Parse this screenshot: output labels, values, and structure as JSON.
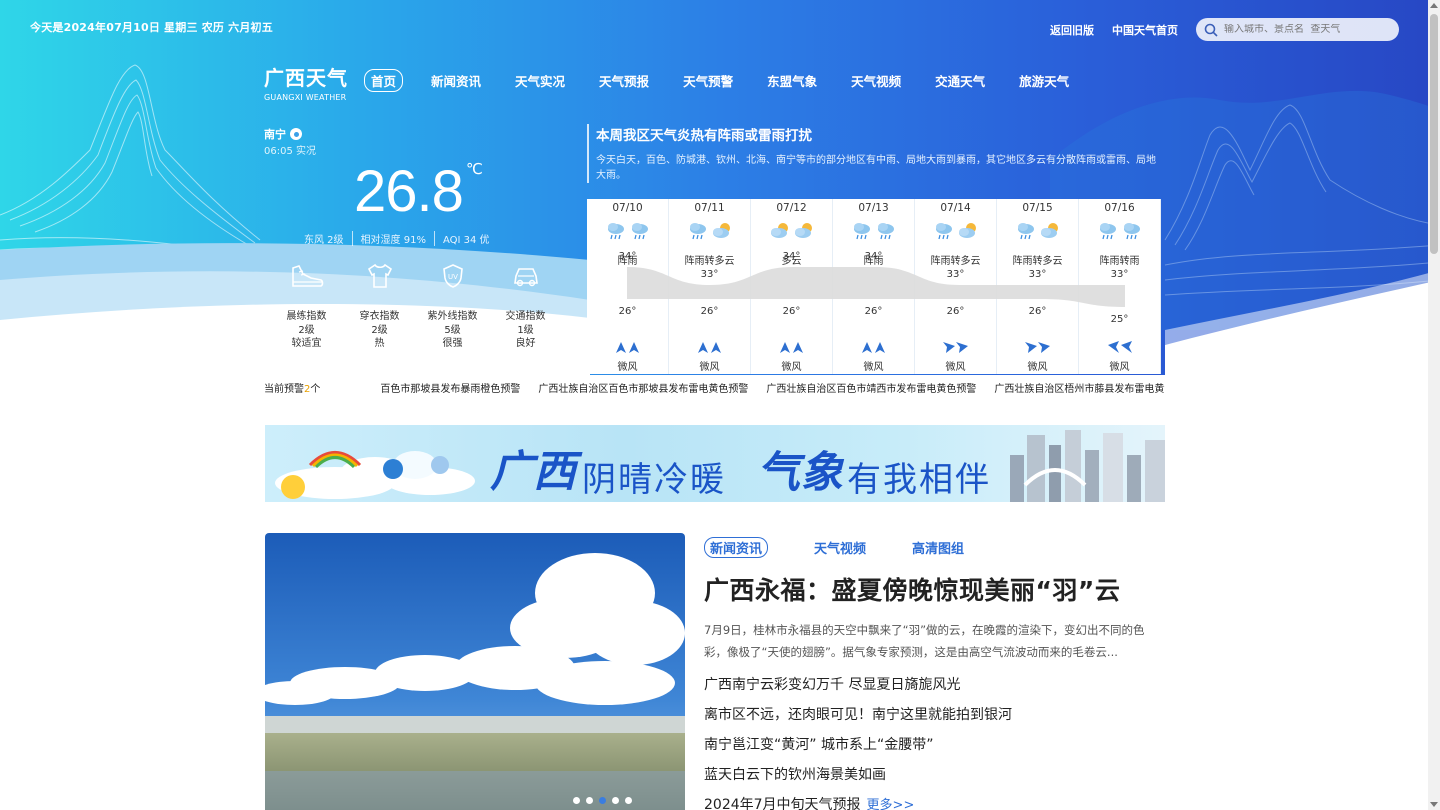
{
  "date_line": "今天是2024年07月10日   星期三   农历 六月初五",
  "top_links": {
    "old_version": "返回旧版",
    "cma_home": "中国天气首页"
  },
  "search": {
    "placeholder": "输入城市、景点名  查天气"
  },
  "logo": {
    "cn": "广西天气",
    "en": "GUANGXI WEATHER"
  },
  "nav": [
    "首页",
    "新闻资讯",
    "天气实况",
    "天气预报",
    "天气预警",
    "东盟气象",
    "天气视频",
    "交通天气",
    "旅游天气"
  ],
  "current": {
    "city": "南宁",
    "obs_time": "06:05 实况",
    "temperature": "26.8",
    "unit": "℃",
    "wind": "东风 2级",
    "humidity": "相对湿度 91%",
    "aqi": "AQI 34 优"
  },
  "indices": [
    {
      "name": "晨练指数",
      "level": "2级",
      "desc": "较适宜",
      "icon": "shoe-icon"
    },
    {
      "name": "穿衣指数",
      "level": "2级",
      "desc": "热",
      "icon": "shirt-icon"
    },
    {
      "name": "紫外线指数",
      "level": "5级",
      "desc": "很强",
      "icon": "uv-shield-icon"
    },
    {
      "name": "交通指数",
      "level": "1级",
      "desc": "良好",
      "icon": "car-icon"
    }
  ],
  "headline": {
    "title": "本周我区天气炎热有阵雨或雷雨打扰",
    "desc": "今天白天，百色、防城港、钦州、北海、南宁等市的部分地区有中雨、局地大雨到暴雨，其它地区多云有分散阵雨或雷雨、局地大雨。"
  },
  "forecast": [
    {
      "date": "07/10",
      "weather": "阵雨",
      "high": "34°",
      "low": "26°",
      "wind": "微风",
      "icons": [
        "rain-icon",
        "rain-icon"
      ],
      "wind_dir": "north-wind-icon"
    },
    {
      "date": "07/11",
      "weather": "阵雨转多云",
      "high": "33°",
      "low": "26°",
      "wind": "微风",
      "icons": [
        "rain-icon",
        "partly-cloudy-icon"
      ],
      "wind_dir": "north-wind-icon"
    },
    {
      "date": "07/12",
      "weather": "多云",
      "high": "34°",
      "low": "26°",
      "wind": "微风",
      "icons": [
        "partly-cloudy-icon",
        "partly-cloudy-icon"
      ],
      "wind_dir": "north-wind-icon"
    },
    {
      "date": "07/13",
      "weather": "阵雨",
      "high": "34°",
      "low": "26°",
      "wind": "微风",
      "icons": [
        "rain-icon",
        "rain-icon"
      ],
      "wind_dir": "north-wind-icon"
    },
    {
      "date": "07/14",
      "weather": "阵雨转多云",
      "high": "33°",
      "low": "26°",
      "wind": "微风",
      "icons": [
        "rain-icon",
        "partly-cloudy-icon"
      ],
      "wind_dir": "east-wind-icon"
    },
    {
      "date": "07/15",
      "weather": "阵雨转多云",
      "high": "33°",
      "low": "26°",
      "wind": "微风",
      "icons": [
        "rain-icon",
        "partly-cloudy-icon"
      ],
      "wind_dir": "east-wind-icon"
    },
    {
      "date": "07/16",
      "weather": "阵雨转雨",
      "high": "33°",
      "low": "25°",
      "wind": "微风",
      "icons": [
        "rain-icon",
        "rain-icon"
      ],
      "wind_dir": "west-wind-icon"
    }
  ],
  "warnings": {
    "count_prefix": "当前预警",
    "count": "2",
    "count_suffix": "个",
    "items": [
      "百色市那坡县发布暴雨橙色预警",
      "广西壮族自治区百色市那坡县发布雷电黄色预警",
      "广西壮族自治区百色市靖西市发布雷电黄色预警",
      "广西壮族自治区梧州市藤县发布雷电黄色预警"
    ]
  },
  "banner": {
    "part1": "广西",
    "part2": "阴晴冷暖",
    "part3": "气象",
    "part4": "有我相伴"
  },
  "news": {
    "tabs": [
      "新闻资讯",
      "天气视频",
      "高清图组"
    ],
    "title": "广西永福：盛夏傍晚惊现美丽“羽”云",
    "summary": "7月9日，桂林市永福县的天空中飘来了“羽”做的云，在晚霞的渲染下，变幻出不同的色彩，像极了“天使的翅膀”。据气象专家预测，这是由高空气流波动而来的毛卷云...",
    "items": [
      "广西南宁云彩变幻万千 尽显夏日旖旎风光",
      "离市区不远，还肉眼可见！南宁这里就能拍到银河",
      "南宁邕江变“黄河” 城市系上“金腰带”",
      "蓝天白云下的钦州海景美如画",
      "2024年7月中旬天气预报"
    ],
    "more": "更多>>"
  }
}
